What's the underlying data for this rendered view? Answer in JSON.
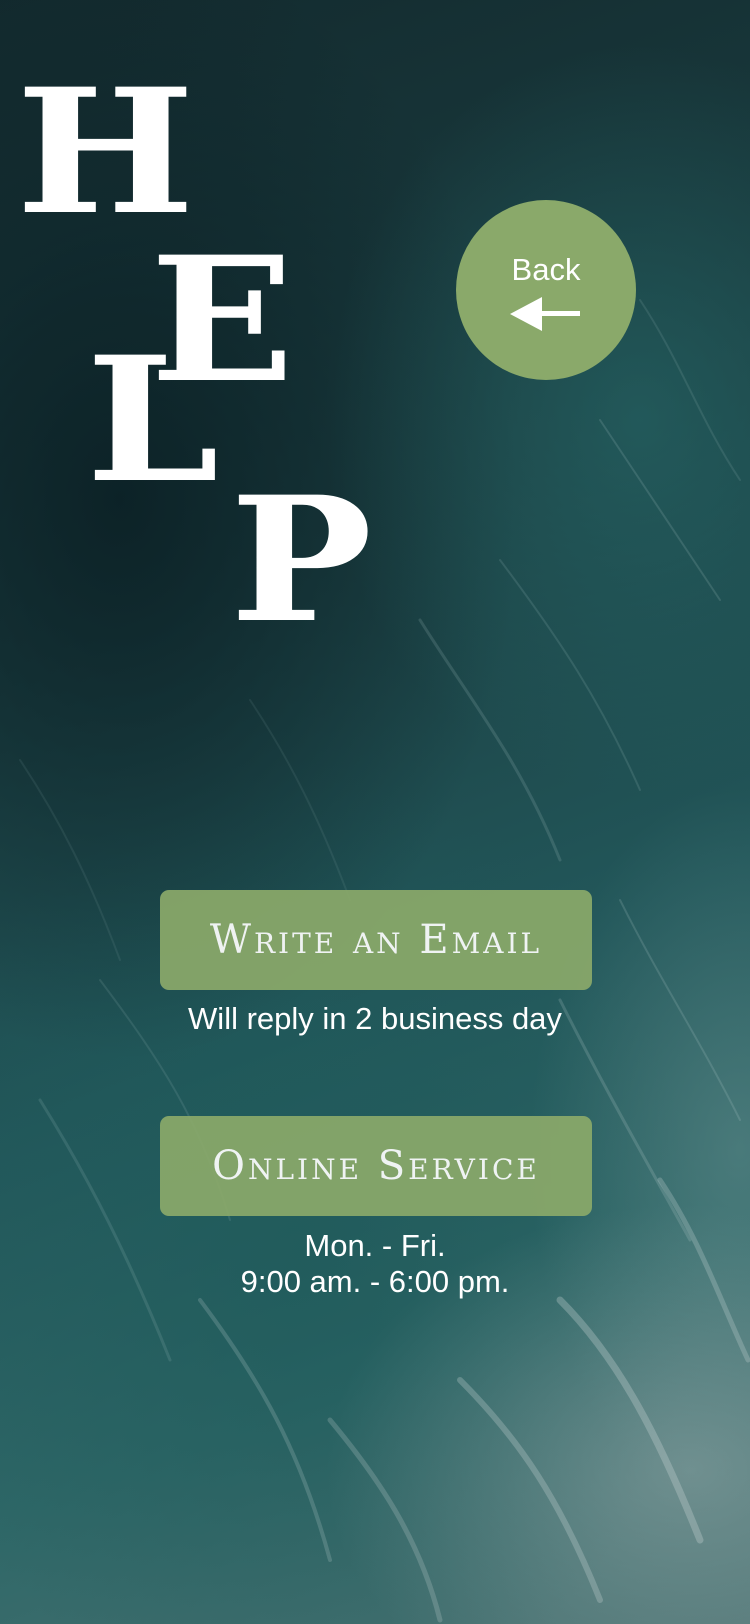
{
  "help_title": {
    "letters": [
      "H",
      "E",
      "L",
      "P"
    ]
  },
  "back_button": {
    "label": "Back",
    "icon": "arrow-left-icon"
  },
  "email": {
    "button_label": "Write an Email",
    "caption": "Will reply in 2 business day"
  },
  "service": {
    "button_label": "Online Service",
    "hours_days": "Mon. - Fri.",
    "hours_time": "9:00 am. - 6:00 pm."
  },
  "colors": {
    "accent_green": "#8aa96a",
    "text": "#ffffff",
    "background_ocean": "#22575a"
  }
}
